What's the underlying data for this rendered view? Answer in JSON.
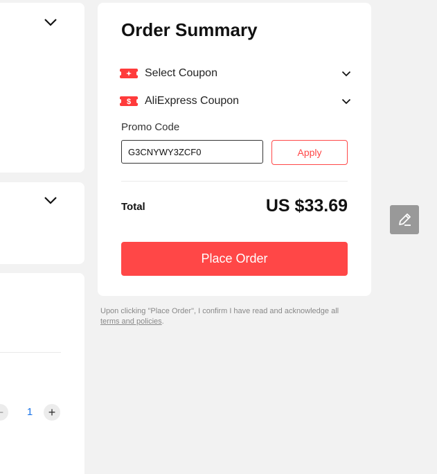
{
  "summary": {
    "title": "Order Summary",
    "select_coupon_label": "Select Coupon",
    "aliexpress_coupon_label": "AliExpress Coupon",
    "promo_code_label": "Promo Code",
    "promo_code_value": "G3CNYWY3ZCF0",
    "apply_label": "Apply",
    "total_label": "Total",
    "total_value": "US $33.69",
    "place_order_label": "Place Order"
  },
  "disclaimer": {
    "text": "Upon clicking \"Place Order\", I confirm I have read and acknowledge all",
    "link_text": "terms and policies",
    "suffix": "."
  },
  "left_panel": {
    "quantity": "1",
    "minus_glyph": "−",
    "plus_glyph": "+"
  },
  "icons": {
    "chevron": "chevron-down-icon",
    "coupon": "coupon-ticket-icon",
    "edit": "pencil-edit-icon"
  },
  "colors": {
    "accent": "#ff4747",
    "background": "#f2f2f2",
    "quantity_text": "#1a73e8"
  }
}
